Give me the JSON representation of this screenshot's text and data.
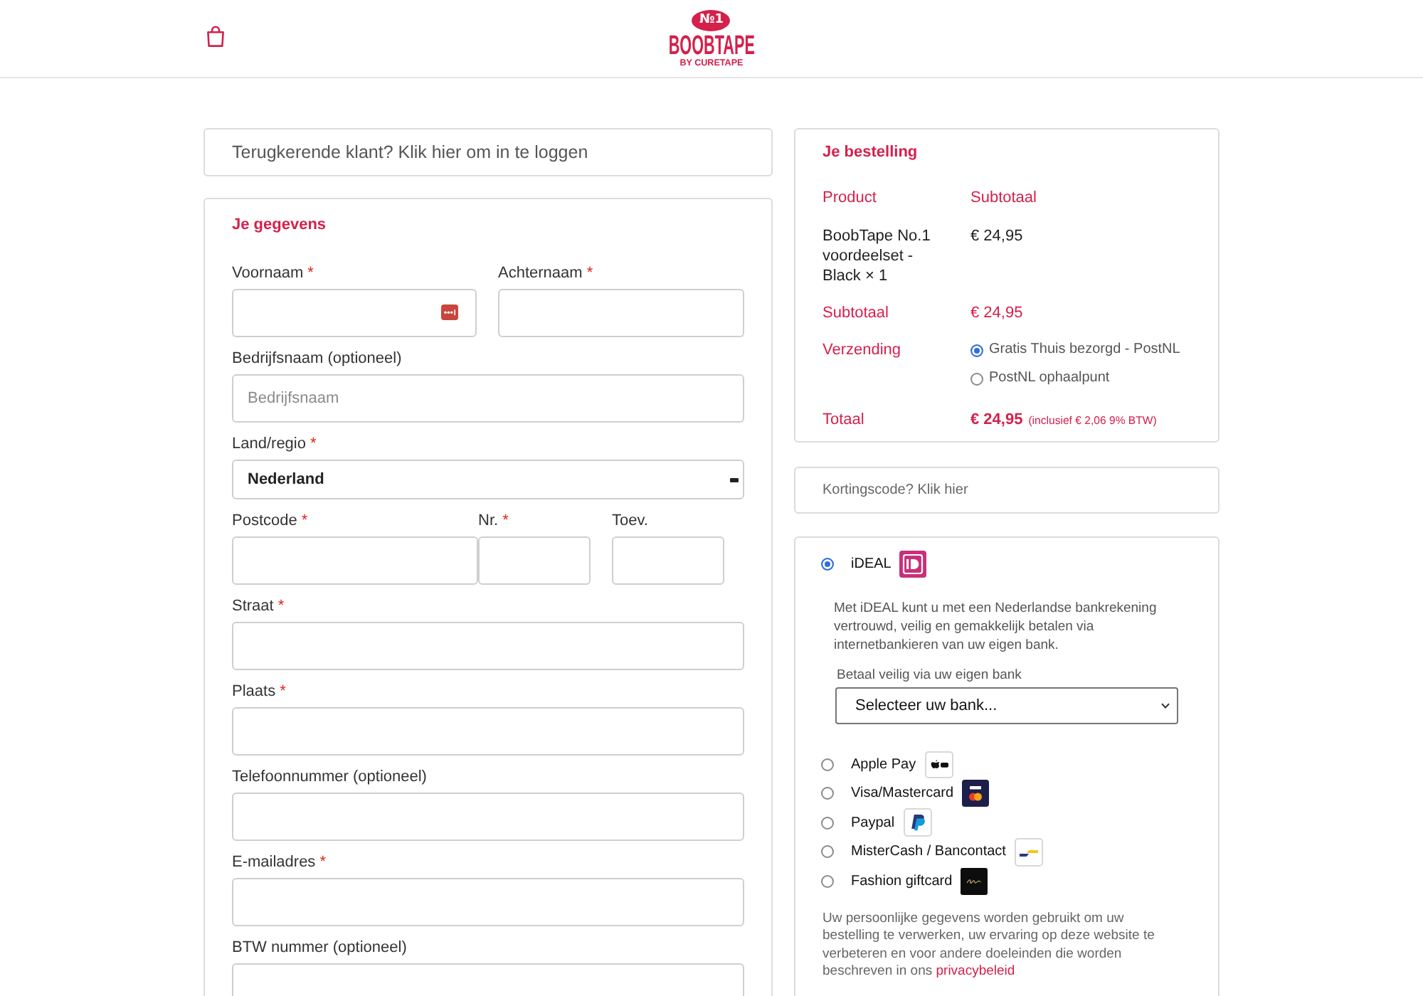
{
  "header": {
    "logo": {
      "badge": "№1",
      "name": "BOOBTAPE",
      "tagline": "BY CURETAPE"
    }
  },
  "login_notice": "Terugkerende klant? Klik hier om in te loggen",
  "billing": {
    "title": "Je gegevens",
    "rows": [
      {
        "kind": "pair",
        "fields": [
          {
            "kind": "input",
            "label": "Voornaam",
            "required_mark": "*"
          },
          {
            "kind": "input",
            "label": "Achternaam",
            "required_mark": "*"
          }
        ]
      },
      {
        "kind": "single",
        "fields": [
          {
            "kind": "input",
            "label": "Bedrijfsnaam (optioneel)",
            "placeholder": "Bedrijfsnaam"
          }
        ]
      },
      {
        "kind": "single",
        "fields": [
          {
            "kind": "select",
            "label": "Land/regio",
            "required_mark": "*",
            "value": "Nederland"
          }
        ]
      },
      {
        "kind": "triple",
        "fields": [
          {
            "kind": "input",
            "label": "Postcode",
            "required_mark": "*"
          },
          {
            "kind": "input",
            "label": "Nr.",
            "required_mark": "*"
          },
          {
            "kind": "input",
            "label": "Toev."
          }
        ]
      },
      {
        "kind": "single",
        "fields": [
          {
            "kind": "input",
            "label": "Straat",
            "required_mark": "*"
          }
        ]
      },
      {
        "kind": "single",
        "fields": [
          {
            "kind": "input",
            "label": "Plaats",
            "required_mark": "*"
          }
        ]
      },
      {
        "kind": "single",
        "fields": [
          {
            "kind": "input",
            "label": "Telefoonnummer (optioneel)"
          }
        ]
      },
      {
        "kind": "single",
        "fields": [
          {
            "kind": "input",
            "label": "E-mailadres",
            "required_mark": "*"
          }
        ]
      },
      {
        "kind": "single",
        "fields": [
          {
            "kind": "input",
            "label": "BTW nummer (optioneel)"
          }
        ]
      }
    ]
  },
  "order": {
    "title": "Je bestelling",
    "columns": [
      "Product",
      "Subtotaal"
    ],
    "items": [
      {
        "name": "BoobTape No.1 voordeelset - Black",
        "quantity": "× 1",
        "subtotal": "€ 24,95"
      }
    ],
    "subtotal": {
      "label": "Subtotaal",
      "value": "€ 24,95"
    },
    "shipping": {
      "label": "Verzending",
      "options": [
        {
          "label": "Gratis Thuis bezorgd - PostNL",
          "selected": true
        },
        {
          "label": "PostNL ophaalpunt",
          "selected": false
        }
      ]
    },
    "total": {
      "label": "Totaal",
      "value": "€ 24,95",
      "tax_note": "(inclusief € 2,06 9% BTW)"
    }
  },
  "coupon_notice": "Kortingscode? Klik hier",
  "payment": {
    "methods": [
      {
        "kind": "ideal",
        "label": "iDEAL",
        "selected": true,
        "description": "Met iDEAL kunt u met een Nederlandse bankrekening vertrouwd, veilig en gemakkelijk betalen via internetbankieren van uw eigen bank.",
        "bank_select": {
          "label": "Betaal veilig via uw eigen bank",
          "value": "Selecteer uw bank..."
        }
      },
      {
        "kind": "applepay",
        "label": "Apple Pay",
        "selected": false
      },
      {
        "kind": "card",
        "label": "Visa/Mastercard",
        "selected": false
      },
      {
        "kind": "paypal",
        "label": "Paypal",
        "selected": false
      },
      {
        "kind": "bancontact",
        "label": "MisterCash / Bancontact",
        "selected": false
      },
      {
        "kind": "giftcard",
        "label": "Fashion giftcard",
        "selected": false
      }
    ],
    "privacy": {
      "text": "Uw persoonlijke gegevens worden gebruikt om uw bestelling te verwerken, uw ervaring op deze website te verbeteren en voor andere doeleinden die worden beschreven in ons",
      "link": "privacybeleid"
    }
  }
}
